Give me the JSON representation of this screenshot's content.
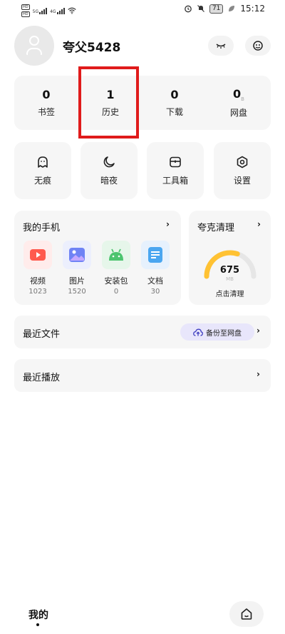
{
  "status_bar": {
    "left_badges": [
      "HD",
      "HD"
    ],
    "signal_labels": [
      "5G",
      "4G"
    ],
    "battery": "71",
    "time": "15:12"
  },
  "profile": {
    "username": "夸父5428"
  },
  "stats": [
    {
      "value": "0",
      "label": "书签"
    },
    {
      "value": "1",
      "label": "历史"
    },
    {
      "value": "0",
      "label": "下载"
    },
    {
      "value": "0",
      "unit": "B",
      "label": "网盘"
    }
  ],
  "tools": [
    {
      "label": "无痕",
      "icon": "ghost-icon"
    },
    {
      "label": "暗夜",
      "icon": "moon-icon"
    },
    {
      "label": "工具箱",
      "icon": "toolbox-icon"
    },
    {
      "label": "设置",
      "icon": "gear-icon"
    }
  ],
  "my_phone": {
    "title": "我的手机",
    "items": [
      {
        "name": "视频",
        "count": "1023",
        "icon": "video-icon",
        "color": "#ff5a4e"
      },
      {
        "name": "图片",
        "count": "1520",
        "icon": "image-icon",
        "color": "#6f83f5"
      },
      {
        "name": "安装包",
        "count": "0",
        "icon": "android-icon",
        "color": "#4cc46f"
      },
      {
        "name": "文档",
        "count": "30",
        "icon": "document-icon",
        "color": "#4aa6f0"
      }
    ]
  },
  "cleaner": {
    "title": "夸克清理",
    "value": "675",
    "unit": "MB",
    "action": "点击清理",
    "gauge_fill": 0.6,
    "gauge_color": "#ffc233"
  },
  "recent_files": {
    "label": "最近文件",
    "backup_label": "备份至网盘"
  },
  "recent_play": {
    "label": "最近播放"
  },
  "bottom": {
    "tab_title": "我的"
  }
}
